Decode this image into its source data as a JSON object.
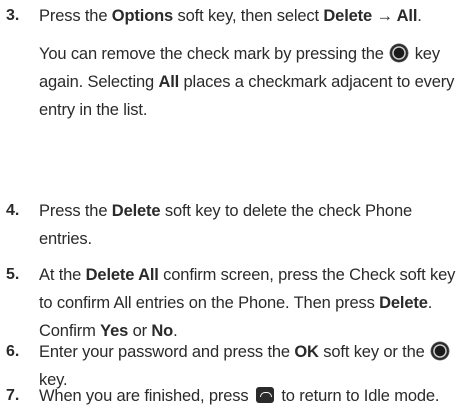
{
  "steps": [
    {
      "number": "3.",
      "lines": [
        [
          "Press the ",
          {
            "b": "Options"
          },
          " soft key, then select ",
          {
            "b": "Delete →  All"
          },
          "."
        ],
        [],
        [
          "You can remove the check mark by pressing the ",
          {
            "icon": "center-key-icon"
          },
          " key"
        ],
        [
          "again. Selecting ",
          {
            "b": "All"
          },
          " places a checkmark adjacent to every"
        ],
        [
          "entry in the list."
        ]
      ]
    },
    {
      "number": "4.",
      "lines": [
        [
          "Press the ",
          {
            "b": "Delete"
          },
          " soft key to delete the check Phone"
        ],
        [
          "entries."
        ]
      ]
    },
    {
      "number": "5.",
      "lines": [
        [
          "At the ",
          {
            "b": "Delete All"
          },
          " confirm screen, press the Check soft key"
        ],
        [
          "to confirm All entries on the Phone. Then press ",
          {
            "b": "Delete"
          },
          "."
        ],
        [
          "Confirm ",
          {
            "b": "Yes"
          },
          " or ",
          {
            "b": "No"
          },
          "."
        ]
      ]
    },
    {
      "number": "6.",
      "lines": [
        [
          "Enter your password and press the ",
          {
            "b": "OK"
          },
          " soft key or the ",
          {
            "icon": "center-key-icon"
          }
        ],
        [
          "key."
        ]
      ]
    },
    {
      "number": "7.",
      "lines": [
        [
          "When you are finished, press ",
          {
            "icon": "end-key-icon"
          },
          " to return to Idle mode."
        ]
      ]
    }
  ]
}
